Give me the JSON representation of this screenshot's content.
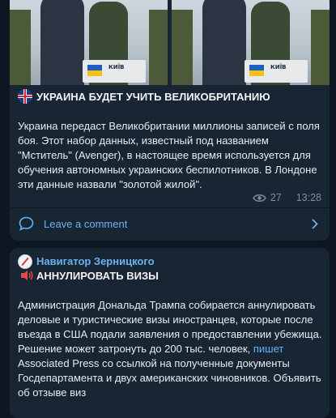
{
  "post1": {
    "photo_caption_1": "КИЇВ",
    "photo_caption_2": "КИЇВ",
    "title": "УКРАИНА БУДЕТ УЧИТЬ ВЕЛИКОБРИТАНИЮ",
    "body": "Украина передаст Великобритании миллионы записей с поля боя. Этот набор данных, известный под названием \"Мститель\" (Avenger), в настоящее время используется для обучения автономных украинских беспилотников. В Лондоне эти данные назвали \"золотой жилой\".",
    "views": "27",
    "time": "13:28",
    "comment_label": "Leave a comment"
  },
  "post2": {
    "channel": "Навигатор Зерницкого",
    "title": "АННУЛИРОВАТЬ ВИЗЫ",
    "body_before_link": "Администрация Дональда Трампа собирается аннулировать деловые и туристические визы иностранцев, которые после въезда в США подали заявления о предоставлении убежища. Решение может затронуть до 200 тыс. человек, ",
    "link": "пишет",
    "body_after_link": " Associated Press со ссылкой на полученные документы Госдепартамента и двух американских чиновников. Объявить об отзыве виз"
  },
  "colors": {
    "background": "#0e1621",
    "card": "#182533",
    "link": "#6ab3f3",
    "meta": "#7f8d9c"
  }
}
